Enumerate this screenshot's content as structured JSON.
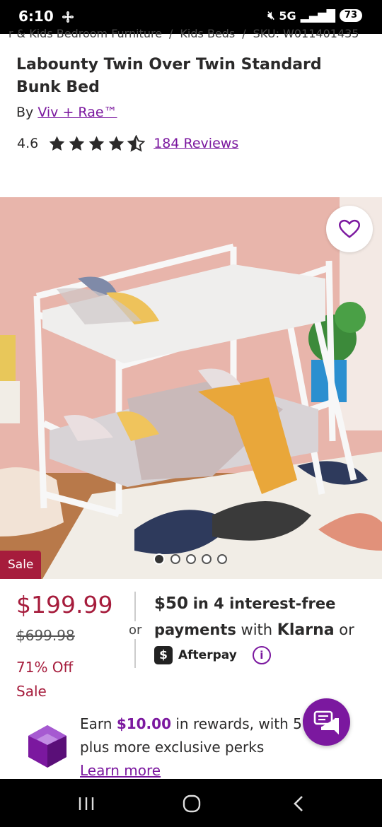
{
  "status_bar": {
    "time": "6:10",
    "network": "5G",
    "battery": "73"
  },
  "breadcrumb": [
    "r & Kids Bedroom Furniture",
    "Kids Beds",
    "SKU: W011401435"
  ],
  "product": {
    "title": "Labounty Twin Over Twin Standard Bunk Bed",
    "by_label": "By",
    "brand": "Viv + Rae™",
    "rating": "4.6",
    "rating_value": 4.6,
    "reviews": "184 Reviews"
  },
  "gallery": {
    "sale_badge": "Sale",
    "image_count": 5,
    "active_index": 0
  },
  "pricing": {
    "price": "$199.99",
    "original_price": "$699.98",
    "discount": "71% Off Sale",
    "or": "or",
    "installment_amount": "$50",
    "installment_text": "in 4 interest-free",
    "payments_word": "payments",
    "with": "with",
    "klarna": "Klarna",
    "or2": "or",
    "afterpay": "Afterpay"
  },
  "rewards": {
    "earn": "Earn",
    "amount": "$10.00",
    "text1": "in rewards, with 5%",
    "text2": "plus more exclusive perks",
    "learn_more": "Learn more"
  },
  "colors": {
    "accent": "#7b189f",
    "sale": "#a61c3c"
  },
  "icons": [
    "fan-icon",
    "heart-icon",
    "star-icon",
    "info-icon",
    "chat-icon",
    "gem-icon",
    "recent-apps-icon",
    "home-icon",
    "back-icon"
  ]
}
